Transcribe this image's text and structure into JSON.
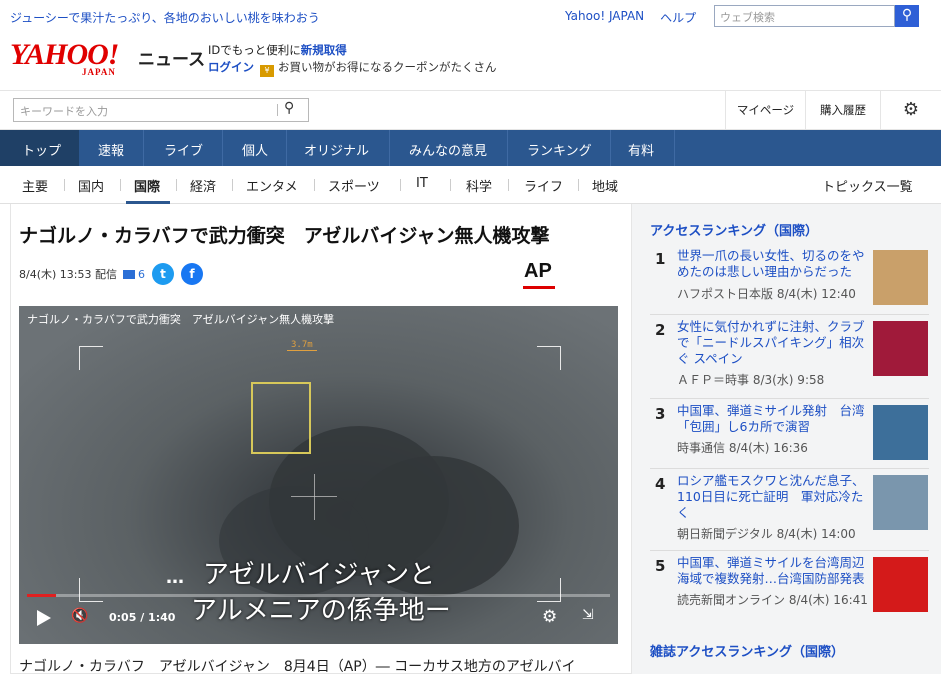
{
  "topbar": {
    "promo": "ジューシーで果汁たっぷり、各地のおいしい桃を味わおう",
    "links": [
      "Yahoo! JAPAN",
      "ヘルプ"
    ],
    "search_placeholder": "ウェブ検索",
    "search_icon": "search-icon"
  },
  "header": {
    "logo_text": "YAHOO!",
    "logo_sub": "JAPAN",
    "section": "ニュース",
    "id_line_prefix": "IDでもっと便利に",
    "id_line_link": "新規取得",
    "login": "ログイン",
    "coupon_text": "お買い物がお得になるクーポンがたくさん"
  },
  "keyword": {
    "placeholder": "キーワードを入力",
    "mypage": "マイページ",
    "history": "購入履歴",
    "settings_icon": "gear-icon"
  },
  "main_nav": [
    "トップ",
    "速報",
    "ライブ",
    "個人",
    "オリジナル",
    "みんなの意見",
    "ランキング",
    "有料"
  ],
  "sub_nav": {
    "items": [
      "主要",
      "国内",
      "国際",
      "経済",
      "エンタメ",
      "スポーツ",
      "IT",
      "科学",
      "ライフ",
      "地域"
    ],
    "active": "国際",
    "topics": "トピックス一覧"
  },
  "article": {
    "headline": "ナゴルノ・カラバフで武力衝突　アゼルバイジャン無人機攻撃",
    "date": "8/4(木) 13:53 配信",
    "comments": "6",
    "source_logo": "AP",
    "video": {
      "title": "ナゴルノ・カラバフで武力衝突　アゼルバイジャン無人機攻撃",
      "range": "3.7m",
      "caption_dots": "…",
      "caption1": "アゼルバイジャンと",
      "caption2": "アルメニアの係争地ー",
      "time": "0:05 / 1:40",
      "progress": 0.05
    },
    "lede": "ナゴルノ・カラバフ　アゼルバイジャン　8月4日（AP）― コーカサス地方のアゼルバイ"
  },
  "sidebar": {
    "heading": "アクセスランキング（国際）",
    "ranking": [
      {
        "num": "1",
        "title": "世界一爪の長い女性、切るのをやめたのは悲しい理由からだった",
        "source": "ハフポスト日本版 8/4(木) 12:40",
        "thumb_color": "#c9a06a"
      },
      {
        "num": "2",
        "title": "女性に気付かれずに注射、クラブで「ニードルスパイキング」相次ぐ スペイン",
        "source": "ＡＦＰ＝時事 8/3(水) 9:58",
        "thumb_color": "#a01a3a"
      },
      {
        "num": "3",
        "title": "中国軍、弾道ミサイル発射　台湾「包囲」し6カ所で演習",
        "source": "時事通信 8/4(木) 16:36",
        "thumb_color": "#3d6f9a"
      },
      {
        "num": "4",
        "title": "ロシア艦モスクワと沈んだ息子、110日目に死亡証明　軍対応冷たく",
        "source": "朝日新聞デジタル 8/4(木) 14:00",
        "thumb_color": "#7a96ad"
      },
      {
        "num": "5",
        "title": "中国軍、弾道ミサイルを台湾周辺海域で複数発射…台湾国防部発表",
        "source": "読売新聞オンライン 8/4(木) 16:41",
        "thumb_color": "#d41a1a"
      }
    ],
    "footer_heading": "雑誌アクセスランキング（国際）"
  }
}
